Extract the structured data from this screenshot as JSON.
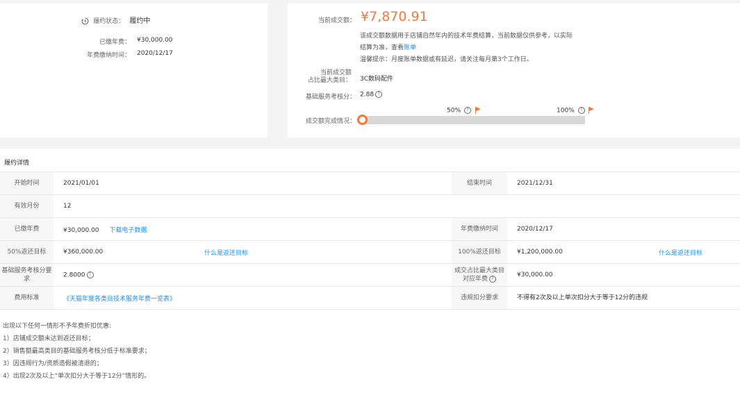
{
  "left_card": {
    "status_label": "履约状态：",
    "status_value": "履约中",
    "paid_fee_label": "已缴年费：",
    "paid_fee_value": "¥30,000.00",
    "pay_time_label": "年费缴纳时间：",
    "pay_time_value": "2020/12/17"
  },
  "right_card": {
    "amount_label": "当前成交额：",
    "amount_value": "¥7,870.91",
    "desc_line1": "该成交额数据用于店铺自然年内的技术年费结算，当前数据仅供参考，以实际",
    "desc_line2": "结算为准，查看",
    "bill_link": "账单",
    "tip": "温馨提示：月度账单数据或有延迟，请关注每月第3个工作日。",
    "category_label_1": "当前成交额",
    "category_label_2": "占比最大类目：",
    "category_value": "3C数码配件",
    "score_label": "基础服务考核分：",
    "score_value": "2.88",
    "progress_label": "成交额完成情况：",
    "marker_50": "50%",
    "marker_100": "100%",
    "progress_percent": 0.66
  },
  "detail": {
    "title": "履约详情",
    "rows": {
      "start_label": "开始时间",
      "start_value": "2021/01/01",
      "end_label": "结束时间",
      "end_value": "2021/12/31",
      "months_label": "有效月份",
      "months_value": "12",
      "paid_label": "已缴年费",
      "paid_value": "¥30,000.00",
      "download_link": "下载电子数据",
      "paytime_label": "年费缴纳时间",
      "paytime_value": "2020/12/17",
      "r50_label": "50%返还目标",
      "r50_value": "¥360,000.00",
      "r50_link": "什么是返还目标",
      "r100_label": "100%返还目标",
      "r100_value": "¥1,200,000.00",
      "r100_link": "什么是返还目标",
      "score_req_label": "基础服务考核分要求",
      "score_req_value": "2.8000",
      "cat_fee_label": "成交占比最大类目对应年费",
      "cat_fee_value": "¥30,000.00",
      "fee_std_label": "费用标准",
      "fee_std_link": "《天猫年度各类目技术服务年费一览表》",
      "violation_label": "违规扣分要求",
      "violation_value": "不得有2次及以上单次扣分大于等于12分的违规"
    },
    "notes": [
      "出现以下任何一情形不予年费折扣优惠:",
      "1）店铺成交额未达到返还目标；",
      "2）销售额最高类目的基础服务考核分低于标准要求；",
      "3）因违规行为/资质造假被清退的；",
      "4）出现2次及以上“单次扣分大于等于12分”情形的。"
    ]
  }
}
